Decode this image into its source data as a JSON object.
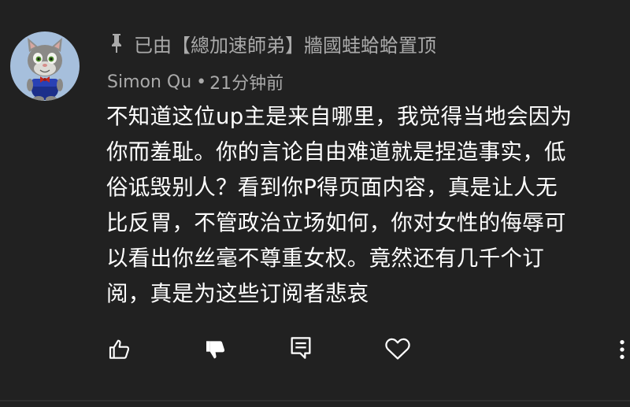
{
  "comment": {
    "pinned_text": "已由【總加速師弟】牆國蛙蛤蛤置顶",
    "author": "Simon Qu",
    "separator": "•",
    "time": "21分钟前",
    "body": "不知道这位up主是来自哪里，我觉得当地会因为\n你而羞耻。你的言论自由难道就是捏造事实，低\n俗诋毁别人？看到你P得页面内容，真是让人无\n比反胃，不管政治立场如何，你对女性的侮辱可\n以看出你丝毫不尊重女权。竟然还有几千个订\n阅，真是为这些订阅者悲哀"
  },
  "actions": {
    "like_icon": "thumb-up-outline",
    "dislike_icon": "thumb-down-filled",
    "reply_icon": "reply-comment",
    "heart_icon": "heart-outline",
    "more_icon": "vertical-dots"
  },
  "colors": {
    "background": "#212121",
    "primary_text": "#ffffff",
    "secondary_text": "#aaaaaa",
    "avatar_bg": "#a6bfdc"
  }
}
